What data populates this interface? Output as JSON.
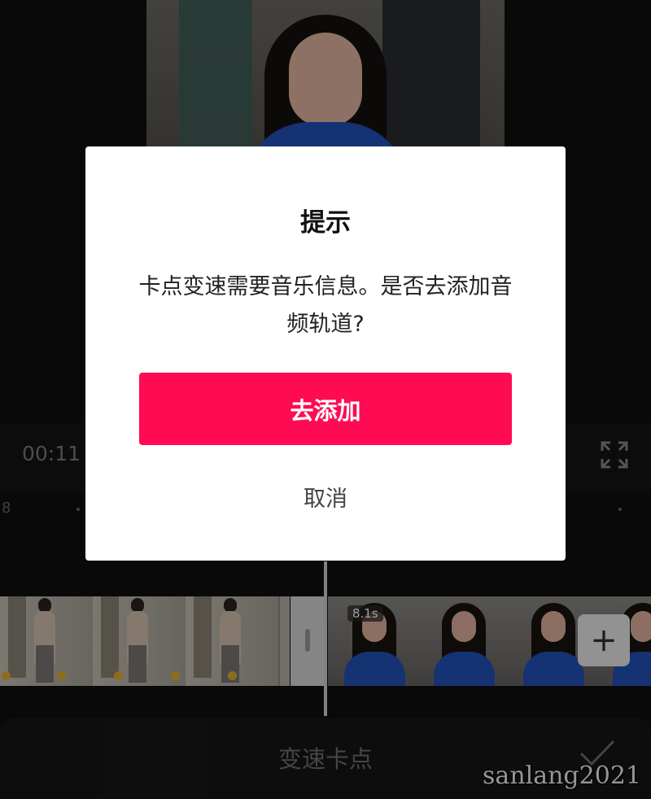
{
  "player": {
    "timecode": "00:11 /"
  },
  "timeline": {
    "ruler_label": "8",
    "clip_duration": "8.1s",
    "add_clip_glyph": "+"
  },
  "bottom_bar": {
    "title": "变速卡点"
  },
  "dialog": {
    "title": "提示",
    "message": "卡点变速需要音乐信息。是否去添加音频轨道?",
    "primary_label": "去添加",
    "cancel_label": "取消"
  },
  "watermark": "sanlang2021",
  "colors": {
    "accent": "#fe0b53",
    "background": "#0f0f0f",
    "dialog_bg": "#ffffff"
  },
  "icons": [
    "fullscreen-icon",
    "checkmark-icon",
    "plus-icon"
  ]
}
